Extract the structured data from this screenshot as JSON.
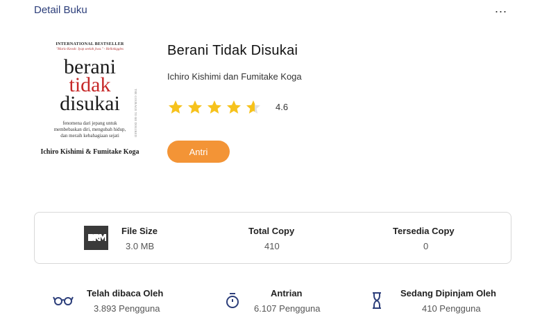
{
  "header": {
    "title": "Detail Buku",
    "more_label": "..."
  },
  "cover": {
    "top_line": "INTERNATIONAL BESTSELLER",
    "quote": "\"Mario Keosh: Iyap seelah jiwa.\" - Hellokiggles",
    "title_word1": "berani",
    "title_word2": "tidak",
    "title_word3": "disukai",
    "tagline": "fenomena dari jepang untuk membebaskan diri, mengubah hidup, dan meraih kebahagiaan sejati",
    "authors": "Ichiro Kishimi & Fumitake Koga",
    "side_text": "THE COURAGE TO BE DISLIKED"
  },
  "book": {
    "title": "Berani Tidak Disukai",
    "author": "Ichiro Kishimi dan Fumitake Koga",
    "rating": 4.6,
    "rating_label": "4.6",
    "star_color": "#f6c21c",
    "star_empty_color": "#e0e0e0",
    "action_label": "Antri",
    "action_color": "#f39436"
  },
  "stats": [
    {
      "label": "File Size",
      "value": "3.0 MB",
      "icon": "drm-icon"
    },
    {
      "label": "Total Copy",
      "value": "410"
    },
    {
      "label": "Tersedia Copy",
      "value": "0"
    }
  ],
  "info": [
    {
      "label": "Telah dibaca Oleh",
      "value": "3.893 Pengguna",
      "icon": "glasses-icon"
    },
    {
      "label": "Antrian",
      "value": "6.107 Pengguna",
      "icon": "stopwatch-icon"
    },
    {
      "label": "Sedang Dipinjam Oleh",
      "value": "410 Pengguna",
      "icon": "hourglass-icon"
    }
  ],
  "icon_color": "#2c3e7a"
}
